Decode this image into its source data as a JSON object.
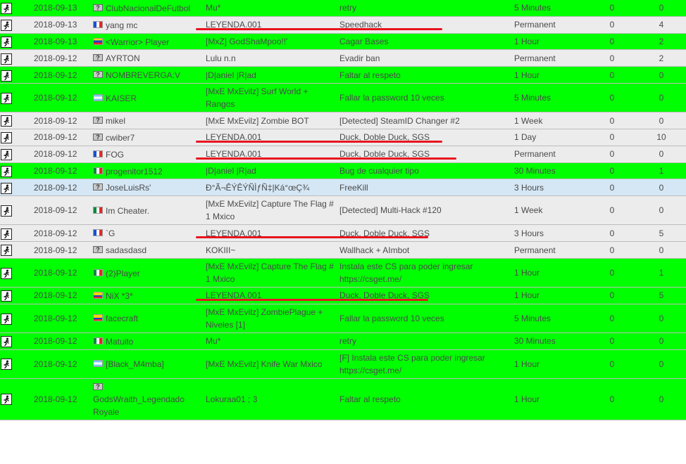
{
  "colors": {
    "green_row": "#00ff00",
    "gray_row": "#ececec",
    "blue_row": "#d5e7f5",
    "annotation": "#e8141e"
  },
  "row_icon": "admin-running-man-icon",
  "rows": [
    {
      "date": "2018-09-13",
      "flag": "unknown",
      "player": "ClubNacionalDeFutbol",
      "admin": "Mu*",
      "reason": "retry",
      "length": "5 Minutes",
      "c1": "0",
      "c2": "0",
      "color": "green"
    },
    {
      "date": "2018-09-13",
      "flag": "fr",
      "player": "yang mc",
      "admin": "LEYENDA.001",
      "reason": "Speedhack",
      "length": "Permanent",
      "c1": "0",
      "c2": "4",
      "color": "gray"
    },
    {
      "date": "2018-09-13",
      "flag": "ve",
      "player": "<Warrior> Player",
      "admin": "[MxZ] GodShaMpoo!!'",
      "reason": "Cagar Bases",
      "length": "1 Hour",
      "c1": "0",
      "c2": "2",
      "color": "green"
    },
    {
      "date": "2018-09-12",
      "flag": "unknown",
      "player": "AYRTON",
      "admin": "Lulu n.n",
      "reason": "Evadir ban",
      "length": "Permanent",
      "c1": "0",
      "c2": "2",
      "color": "gray"
    },
    {
      "date": "2018-09-12",
      "flag": "unknown",
      "player": "NOMBREVERGA:V",
      "admin": "|D|aniel |R|ad",
      "reason": "Faltar al respeto",
      "length": "1 Hour",
      "c1": "0",
      "c2": "0",
      "color": "green"
    },
    {
      "date": "2018-09-12",
      "flag": "ar",
      "player": "KAISER",
      "admin": "[MxE MxEvilz] Surf World + Rangos",
      "reason": "Fallar la password 10 veces",
      "length": "5 Minutes",
      "c1": "0",
      "c2": "0",
      "color": "green"
    },
    {
      "date": "2018-09-12",
      "flag": "unknown",
      "player": "mikel",
      "admin": "[MxE MxEvilz] Zombie BOT",
      "reason": "[Detected] SteamID Changer #2",
      "length": "1 Week",
      "c1": "0",
      "c2": "0",
      "color": "gray"
    },
    {
      "date": "2018-09-12",
      "flag": "unknown",
      "player": "cwiber7",
      "admin": "LEYENDA.001",
      "reason": "Duck, Doble Duck, SGS",
      "length": "1 Day",
      "c1": "0",
      "c2": "10",
      "color": "gray"
    },
    {
      "date": "2018-09-12",
      "flag": "fr",
      "player": "FOG",
      "admin": "LEYENDA.001",
      "reason": "Duck, Doble Duck, SGS",
      "length": "Permanent",
      "c1": "0",
      "c2": "0",
      "color": "gray"
    },
    {
      "date": "2018-09-12",
      "flag": "mx",
      "player": "progenitor1512",
      "admin": "|D|aniel |R|ad",
      "reason": "Bug de cualquier tipo",
      "length": "30 Minutes",
      "c1": "0",
      "c2": "1",
      "color": "green"
    },
    {
      "date": "2018-09-12",
      "flag": "unknown",
      "player": "JoseLuisRs'",
      "admin": "Ð°Ã¬ÊÝÊÝÑÌƒÑ‡|Ká°œÇ¾",
      "reason": "FreeKill",
      "length": "3 Hours",
      "c1": "0",
      "c2": "0",
      "color": "blue"
    },
    {
      "date": "2018-09-12",
      "flag": "mx",
      "player": "Im Cheater.",
      "admin": "[MxE MxEvilz] Capture The Flag # 1 Mxico",
      "reason": "[Detected] Multi-Hack #120",
      "length": "1 Week",
      "c1": "0",
      "c2": "0",
      "color": "gray"
    },
    {
      "date": "2018-09-12",
      "flag": "fr",
      "player": "`G",
      "admin": "LEYENDA.001",
      "reason": "Duck, Doble Duck, SGS",
      "length": "3 Hours",
      "c1": "0",
      "c2": "5",
      "color": "gray"
    },
    {
      "date": "2018-09-12",
      "flag": "unknown",
      "player": "sadasdasd",
      "admin": "KOKIII~",
      "reason": "Wallhack + AImbot",
      "length": "Permanent",
      "c1": "0",
      "c2": "0",
      "color": "gray"
    },
    {
      "date": "2018-09-12",
      "flag": "mx",
      "player": "(2)Player",
      "admin": "[MxE MxEvilz] Capture The Flag # 1 Mxico",
      "reason": "Instala este CS para poder ingresar https://csget.me/",
      "length": "1 Hour",
      "c1": "0",
      "c2": "1",
      "color": "green"
    },
    {
      "date": "2018-09-12",
      "flag": "co",
      "player": "NiX *3*",
      "admin": "LEYENDA.001",
      "reason": "Duck, Doble Duck, SGS",
      "length": "1 Hour",
      "c1": "0",
      "c2": "5",
      "color": "green"
    },
    {
      "date": "2018-09-12",
      "flag": "co",
      "player": "facecraft",
      "admin": "[MxE MxEvilz] ZombiePlague + Niveles [1]",
      "reason": "Fallar la password 10 veces",
      "length": "5 Minutes",
      "c1": "0",
      "c2": "0",
      "color": "green"
    },
    {
      "date": "2018-09-12",
      "flag": "mx",
      "player": "Matuito",
      "admin": "Mu*",
      "reason": "retry",
      "length": "30 Minutes",
      "c1": "0",
      "c2": "0",
      "color": "green"
    },
    {
      "date": "2018-09-12",
      "flag": "ar",
      "player": "[Black_M4mba]",
      "admin": "[MxE MxEvilz] Knife War Mxico",
      "reason": "[F] Instala este CS para poder ingresar https://csget.me/",
      "length": "1 Hour",
      "c1": "0",
      "c2": "0",
      "color": "green"
    },
    {
      "date": "2018-09-12",
      "flag": "unknown",
      "player": "GodsWraith_Legendado Royale",
      "admin": "Lokuraa01 ; 3",
      "reason": "Faltar al respeto",
      "length": "1 Hour",
      "c1": "0",
      "c2": "0",
      "color": "green",
      "name_block": true
    }
  ]
}
